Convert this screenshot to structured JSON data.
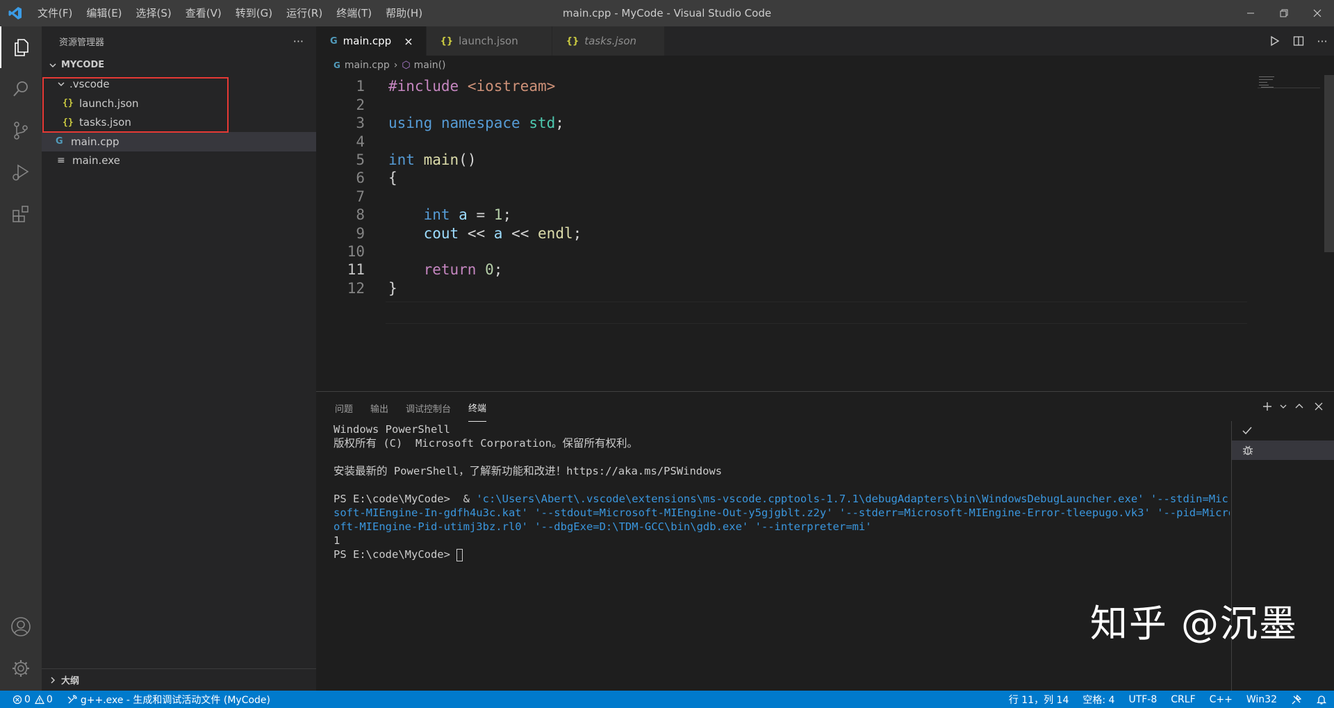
{
  "window": {
    "title": "main.cpp - MyCode - Visual Studio Code",
    "menu": [
      "文件(F)",
      "编辑(E)",
      "选择(S)",
      "查看(V)",
      "转到(G)",
      "运行(R)",
      "终端(T)",
      "帮助(H)"
    ]
  },
  "sidebar": {
    "title": "资源管理器",
    "more": "···",
    "root": "MYCODE",
    "folder": ".vscode",
    "files_in_folder": [
      "launch.json",
      "tasks.json"
    ],
    "files": [
      "main.cpp",
      "main.exe"
    ],
    "outline": "大纲"
  },
  "tabs": [
    {
      "label": "main.cpp",
      "icon": "cpp-icon",
      "active": true
    },
    {
      "label": "launch.json",
      "icon": "json-icon",
      "active": false
    },
    {
      "label": "tasks.json",
      "icon": "json-icon",
      "active": false
    }
  ],
  "breadcrumb": {
    "file": "main.cpp",
    "symbol": "main()"
  },
  "editor": {
    "line_numbers": [
      "1",
      "2",
      "3",
      "4",
      "5",
      "6",
      "7",
      "8",
      "9",
      "10",
      "11",
      "12"
    ],
    "current_line": 11
  },
  "panel": {
    "tabs": [
      "问题",
      "输出",
      "调试控制台",
      "终端"
    ],
    "active_tab": "终端",
    "terminal_lines": [
      "Windows PowerShell",
      "版权所有 (C)  Microsoft Corporation。保留所有权利。",
      "",
      "安装最新的 PowerShell，了解新功能和改进！https://aka.ms/PSWindows",
      "",
      "PS E:\\code\\MyCode>  & ",
      "soft-MIEngine-In-gdfh4u3c.kat' '--stdout=Microsoft-MIEngine-Out-y5gjgblt.z2y' '--stderr=Microsoft-MIEngine-Error-tleepugo.vk3' '--pid=Micros",
      "oft-MIEngine-Pid-utimj3bz.rl0' '--dbgExe=D:\\TDM-GCC\\bin\\gdb.exe' '--interpreter=mi'",
      "1",
      "PS E:\\code\\MyCode> "
    ],
    "command_head": "'c:\\Users\\Abert\\.vscode\\extensions\\ms-vscode.cpptools-1.7.1\\debugAdapters\\bin\\WindowsDebugLauncher.exe' '--stdin=Micro",
    "terminal_list_icons": [
      "check-icon",
      "debug-icon"
    ]
  },
  "watermark": "知乎 @沉墨",
  "status": {
    "errors": "0",
    "warnings": "0",
    "task": "g++.exe - 生成和调试活动文件 (MyCode)",
    "position": "行 11，列 14",
    "spaces": "空格: 4",
    "encoding": "UTF-8",
    "eol": "CRLF",
    "language": "C++",
    "platform": "Win32"
  },
  "colors": {
    "accent": "#007acc",
    "highlight_box": "#e53935"
  }
}
